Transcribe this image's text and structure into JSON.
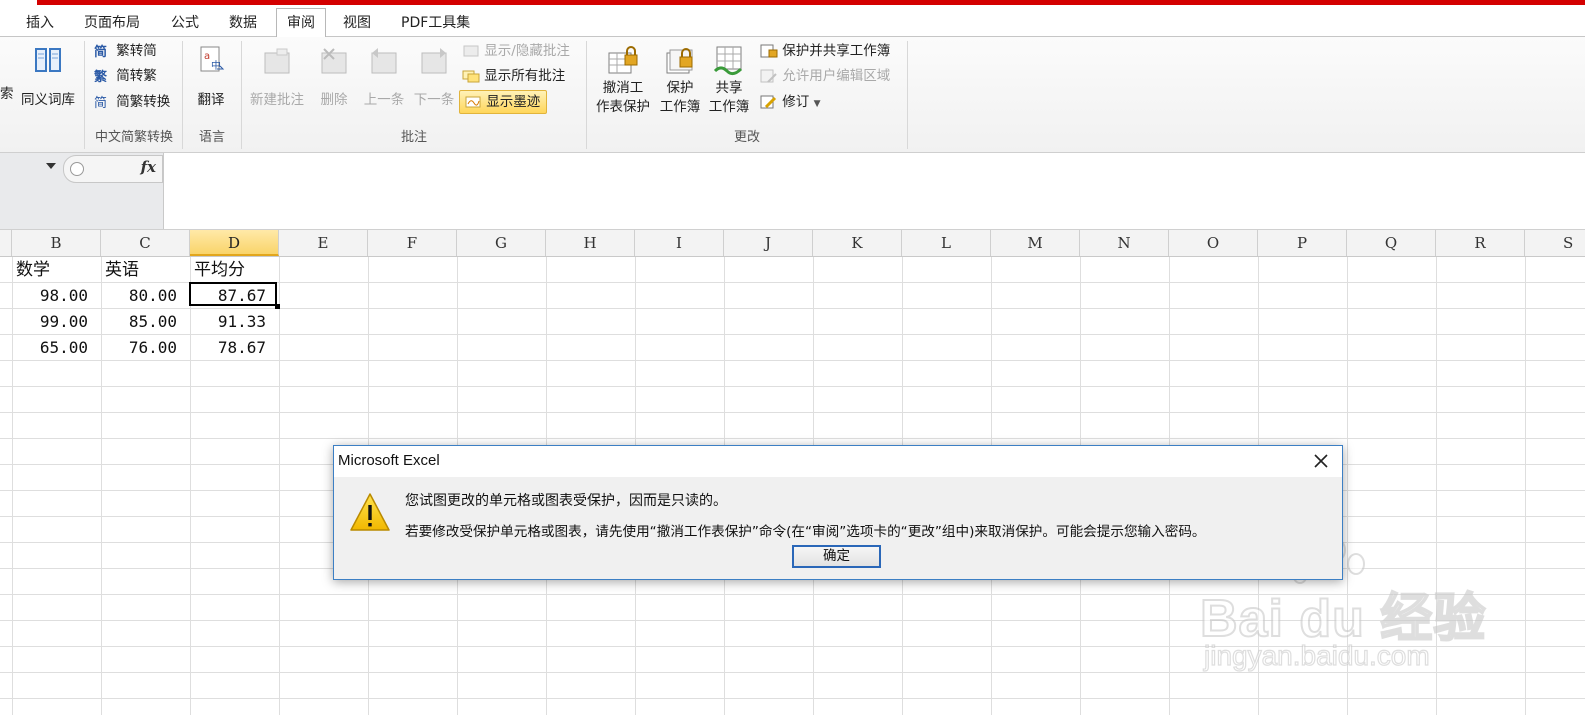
{
  "tabs": [
    {
      "label": "插入",
      "active": false
    },
    {
      "label": "页面布局",
      "active": false
    },
    {
      "label": "公式",
      "active": false
    },
    {
      "label": "数据",
      "active": false
    },
    {
      "label": "审阅",
      "active": true
    },
    {
      "label": "视图",
      "active": false
    },
    {
      "label": "PDF工具集",
      "active": false
    }
  ],
  "ribbon": {
    "proofing": {
      "search_partial": "索",
      "thesaurus": "同义词库"
    },
    "chinese": {
      "to_simplified": "繁转简",
      "to_traditional": "简转繁",
      "convert": "简繁转换",
      "group_label": "中文简繁转换"
    },
    "language": {
      "translate": "翻译",
      "group_label": "语言"
    },
    "comments": {
      "new": "新建批注",
      "delete": "删除",
      "prev": "上一条",
      "next": "下一条",
      "show_hide": "显示/隐藏批注",
      "show_all": "显示所有批注",
      "show_ink": "显示墨迹",
      "group_label": "批注"
    },
    "changes": {
      "unprotect_line1": "撤消工",
      "unprotect_line2": "作表保护",
      "protect_wb_line1": "保护",
      "protect_wb_line2": "工作簿",
      "share_wb_line1": "共享",
      "share_wb_line2": "工作簿",
      "protect_share": "保护并共享工作簿",
      "allow_edit": "允许用户编辑区域",
      "track": "修订",
      "group_label": "更改"
    }
  },
  "formula_bar": {
    "fx": "fx"
  },
  "columns": [
    "B",
    "C",
    "D",
    "E",
    "F",
    "G",
    "H",
    "I",
    "J",
    "K",
    "L",
    "M",
    "N",
    "O",
    "P",
    "Q",
    "R",
    "S"
  ],
  "selected_column": "D",
  "sheet": {
    "header": [
      "数学",
      "英语",
      "平均分"
    ],
    "rows": [
      [
        "98.00",
        "80.00",
        "87.67"
      ],
      [
        "99.00",
        "85.00",
        "91.33"
      ],
      [
        "65.00",
        "76.00",
        "78.67"
      ]
    ]
  },
  "dialog": {
    "title": "Microsoft Excel",
    "line1": "您试图更改的单元格或图表受保护，因而是只读的。",
    "line2": "若要修改受保护单元格或图表，请先使用“撤消工作表保护”命令(在“审阅”选项卡的“更改”组中)来取消保护。可能会提示您输入密码。",
    "ok": "确定"
  },
  "watermark": {
    "brand": "Bai du 经验",
    "url": "jingyan.baidu.com"
  }
}
